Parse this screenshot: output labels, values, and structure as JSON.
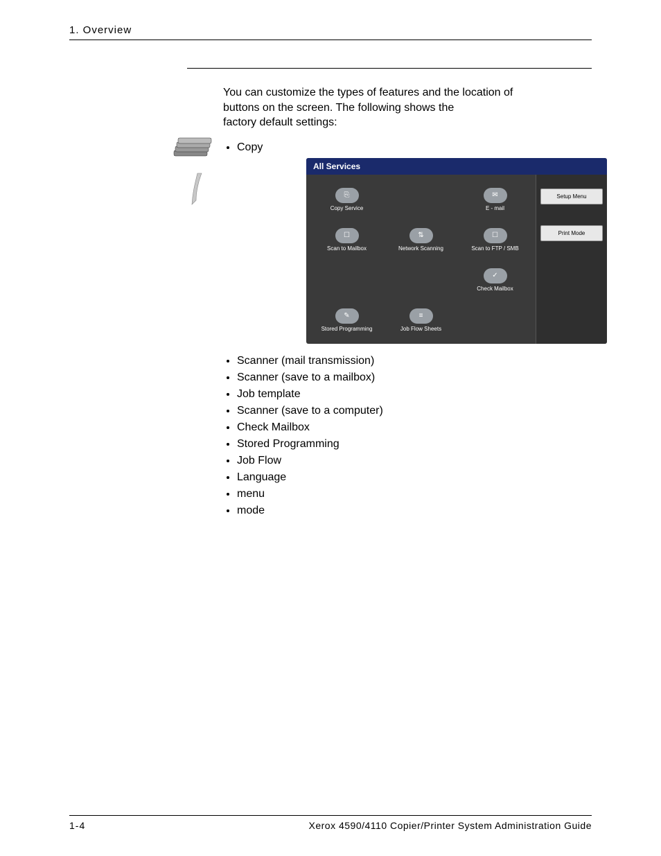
{
  "header": {
    "section": "1. Overview"
  },
  "intro": {
    "line1_a": "You can customize the types of features and the location of",
    "line2_a": "buttons on the ",
    "line2_b": " screen.  The following shows the",
    "line3": "factory default settings:"
  },
  "note": {
    "label": "",
    "text": ""
  },
  "copy_bullet": "Copy",
  "ui": {
    "title": "All Services",
    "services": [
      {
        "label": "Copy Service",
        "icon": "copy"
      },
      {
        "label": "",
        "icon": ""
      },
      {
        "label": "E - mail",
        "icon": "mail"
      },
      {
        "label": "Scan to Mailbox",
        "icon": "scan-mailbox"
      },
      {
        "label": "Network Scanning",
        "icon": "net-scan"
      },
      {
        "label": "Scan to FTP / SMB",
        "icon": "scan-ftp"
      },
      {
        "label": "",
        "icon": ""
      },
      {
        "label": "",
        "icon": ""
      },
      {
        "label": "Check Mailbox",
        "icon": "check-mailbox"
      },
      {
        "label": "Stored Programming",
        "icon": "stored-prog"
      },
      {
        "label": "Job Flow Sheets",
        "icon": "job-flow"
      },
      {
        "label": "",
        "icon": ""
      }
    ],
    "side": {
      "setup": "Setup Menu",
      "print": "Print Mode"
    }
  },
  "features": [
    "Scanner (mail transmission)",
    "Scanner (save to a mailbox)",
    "Job template",
    "Scanner (save to a computer)",
    "Check Mailbox",
    "Stored Programming",
    "Job Flow",
    "Language",
    "        menu",
    "         mode"
  ],
  "footer": {
    "page": "1-4",
    "title": "Xerox 4590/4110 Copier/Printer System Administration Guide"
  }
}
